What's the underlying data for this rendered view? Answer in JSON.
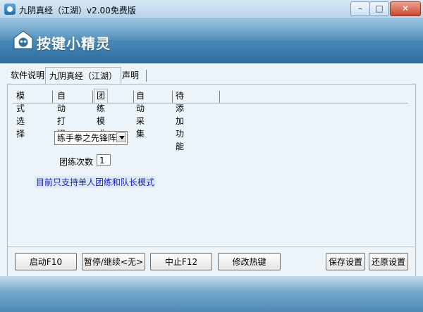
{
  "window": {
    "title": "九阴真经（江湖）v2.00免费版",
    "minimize_glyph": "–",
    "maximize_glyph": "□",
    "close_glyph": "✕"
  },
  "banner": {
    "logo_text": "按键小精灵",
    "logo_icon": "sprite-logo-icon"
  },
  "main_tabs": [
    {
      "label": "软件说明"
    },
    {
      "label": "九阴真经（江湖）"
    },
    {
      "label": "声明"
    }
  ],
  "sub_tabs": [
    {
      "label": "模式选择"
    },
    {
      "label": "自动打怪"
    },
    {
      "label": "团练模式"
    },
    {
      "label": "自动采集"
    },
    {
      "label": "待添加功能"
    }
  ],
  "form": {
    "combo_value": "练手拳之先锋阵",
    "count_label": "团练次数",
    "count_value": "1",
    "note": "目前只支持单人团练和队长模式"
  },
  "buttons": {
    "start": "启动F10",
    "pause": "暂停/继续<无>",
    "stop": "中止F12",
    "hotkey": "修改热键",
    "save": "保存设置",
    "restore": "还原设置"
  },
  "colors": {
    "note_text": "#1c1cc8",
    "banner": "#3d7fb0"
  }
}
